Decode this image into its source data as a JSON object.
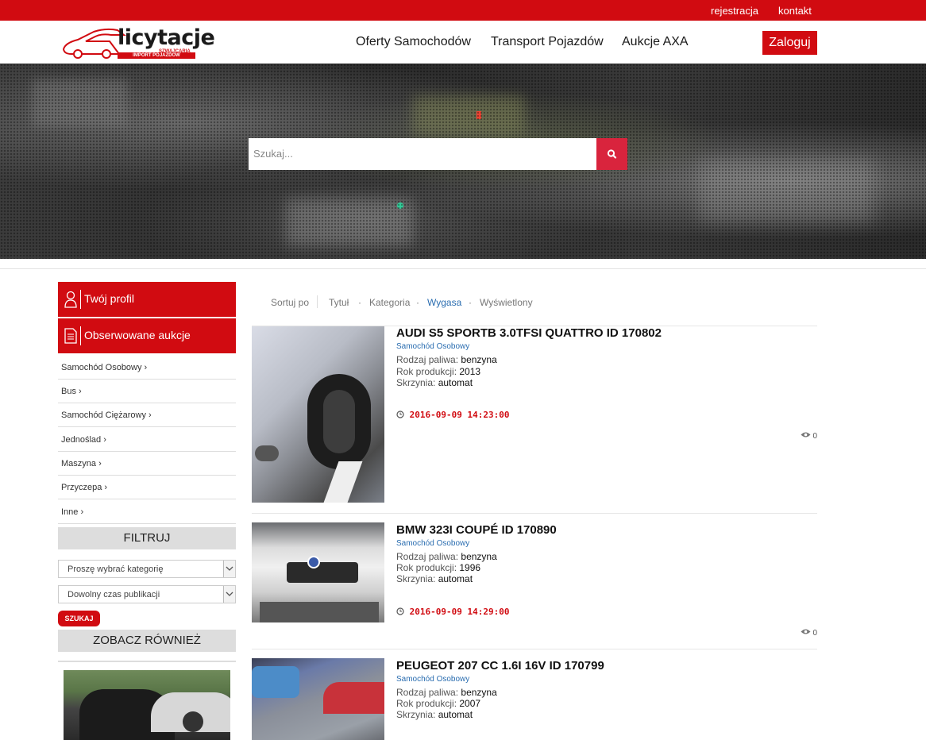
{
  "topbar": {
    "register": "rejestracja",
    "contact": "kontakt"
  },
  "logo": {
    "name": "licytacje",
    "tagline": "SZWAJCARIA",
    "subline": "IMPORT POJAZDÓW"
  },
  "nav": {
    "items": [
      "Oferty Samochodów",
      "Transport Pojazdów",
      "Aukcje AXA"
    ],
    "login": "Zaloguj"
  },
  "search": {
    "placeholder": "Szukaj..."
  },
  "sidebar": {
    "profile": "Twój profil",
    "watched": "Obserwowane aukcje",
    "categories": [
      "Samochód Osobowy",
      "Bus",
      "Samochód Ciężarowy",
      "Jednoślad",
      "Maszyna",
      "Przyczepa",
      "Inne"
    ],
    "filter_title": "FILTRUJ",
    "select_category": "Proszę wybrać kategorię",
    "select_time": "Dowolny czas publikacji",
    "search_button": "SZUKAJ",
    "see_also": "ZOBACZ RÓWNIEŻ"
  },
  "sort": {
    "label": "Sortuj po",
    "options": [
      "Tytuł",
      "Kategoria",
      "Wygasa",
      "Wyświetlony"
    ],
    "active": "Wygasa",
    "active_color": "#2a6db0"
  },
  "labels": {
    "fuel": "Rodzaj paliwa:",
    "year": "Rok produkcji:",
    "gearbox": "Skrzynia:"
  },
  "listings": [
    {
      "title": "AUDI S5 SPORTB 3.0TFSI QUATTRO ID 170802",
      "category": "Samochód Osobowy",
      "fuel": "benzyna",
      "year": "2013",
      "gearbox": "automat",
      "date": "2016-09-09 14:23:00",
      "views": "0"
    },
    {
      "title": "BMW 323I COUPÉ ID 170890",
      "category": "Samochód Osobowy",
      "fuel": "benzyna",
      "year": "1996",
      "gearbox": "automat",
      "date": "2016-09-09 14:29:00",
      "views": "0"
    },
    {
      "title": "PEUGEOT 207 CC 1.6I 16V ID 170799",
      "category": "Samochód Osobowy",
      "fuel": "benzyna",
      "year": "2007",
      "gearbox": "automat"
    }
  ],
  "colors": {
    "brand_red": "#d10b11",
    "search_button": "#d9243d",
    "link_blue": "#2a6db0"
  }
}
